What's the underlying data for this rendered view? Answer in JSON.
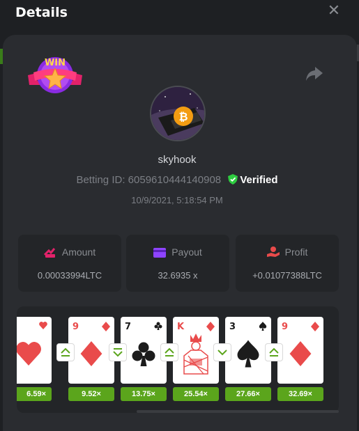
{
  "header": {
    "title": "Details",
    "close_icon": "close-icon"
  },
  "bet": {
    "username": "skyhook",
    "betting_id_label": "Betting ID:",
    "betting_id": "6059610444140908",
    "verified_label": "Verified",
    "date": "10/9/2021, 5:18:54 PM"
  },
  "badge": {
    "text": "WIN"
  },
  "stats": {
    "amount": {
      "label": "Amount",
      "value": "0.00033994LTC",
      "icon": "amount-icon"
    },
    "payout": {
      "label": "Payout",
      "value": "32.6935 x",
      "icon": "payout-icon"
    },
    "profit": {
      "label": "Profit",
      "value": "+0.01077388LTC",
      "icon": "profit-icon"
    }
  },
  "cards": [
    {
      "rank": "",
      "suit": "hearts",
      "multiplier": "6.59×"
    },
    {
      "rank": "9",
      "suit": "diamonds",
      "multiplier": "9.52×"
    },
    {
      "rank": "7",
      "suit": "clubs",
      "multiplier": "13.75×"
    },
    {
      "rank": "K",
      "suit": "diamonds",
      "multiplier": "25.54×"
    },
    {
      "rank": "3",
      "suit": "spades",
      "multiplier": "27.66×"
    },
    {
      "rank": "9",
      "suit": "diamonds",
      "multiplier": "32.69×"
    }
  ],
  "guesses": [
    "higher",
    "lower",
    "higher",
    "lower",
    "higher"
  ],
  "colors": {
    "accent_green": "#5ba51c",
    "verified_green": "#2ecc40",
    "card_red": "#e94b4b"
  }
}
